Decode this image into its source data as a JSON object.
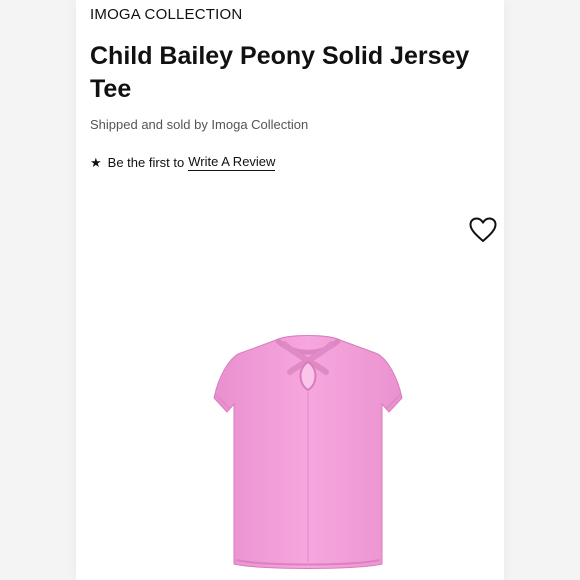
{
  "product": {
    "brand": "IMOGA COLLECTION",
    "title": "Child Bailey Peony Solid Jersey Tee",
    "seller_text": "Shipped and sold by Imoga Collection",
    "review_prompt": "Be the first to",
    "review_link": "Write A Review",
    "image_alt": "Pink child's short-sleeve jersey tee, back view with cross-back keyhole",
    "tee_color": "#f7a5dd"
  },
  "icons": {
    "review_star": "★",
    "favorite": "heart-outline-icon"
  }
}
